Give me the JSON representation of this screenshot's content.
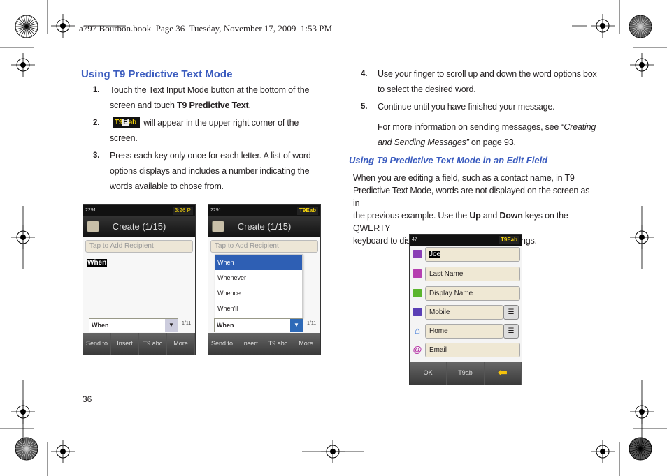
{
  "header": "a797 Bourbon.book  Page 36  Tuesday, November 17, 2009  1:53 PM",
  "left": {
    "heading": "Using T9 Predictive Text Mode",
    "steps": [
      {
        "num": "1.",
        "line1": "Touch the Text Input Mode button at the bottom of the",
        "line2a": "screen and touch ",
        "line2b": "T9 Predictive Text",
        "line2c": "."
      },
      {
        "num": "2.",
        "badge": "T9Eab",
        "line1": "will appear in the upper right corner of the",
        "line2": "screen."
      },
      {
        "num": "3.",
        "line1": "Press each key only once for each letter. A list of word",
        "line2": "options displays and includes a number indicating the",
        "line3": "words available to chose from."
      }
    ]
  },
  "phone1": {
    "status": "2291",
    "time": "3:26 P",
    "title": "Create (1/15)",
    "recipient": "Tap to Add Recipient",
    "text": "When",
    "combo": "When",
    "count": "1/11",
    "buttons": [
      "Send to",
      "Insert",
      "T9 abc",
      "More"
    ]
  },
  "phone2": {
    "status": "2291",
    "mode": "T9Eab",
    "title": "Create (1/15)",
    "recipient": "Tap to Add Recipient",
    "options": [
      "When",
      "Whenever",
      "Whence",
      "When'll"
    ],
    "combo": "When",
    "count": "1/11",
    "buttons": [
      "Send to",
      "Insert",
      "T9 abc",
      "More"
    ]
  },
  "right": {
    "steps": [
      {
        "num": "4.",
        "line1": "Use your finger to scroll up and down the word options box",
        "line2": "to select the desired word."
      },
      {
        "num": "5.",
        "line1": "Continue until you have finished your message."
      }
    ],
    "more1": "For more information on sending messages, see ",
    "more_italic1": "“Creating",
    "more_italic2": "and Sending Messages”",
    "more2": " on page 93.",
    "subheading": "Using T9 Predictive Text Mode in an Edit Field",
    "para": {
      "l1": "When you are editing a field, such as a contact name, in T9",
      "l2": "Predictive Text Mode, words are not displayed on the screen as in",
      "l3": "the previous example. Use the ",
      "up": "Up",
      "and": " and ",
      "down": "Down",
      "l3b": " keys on the QWERTY",
      "l4": "keyboard to display different suggested spellings."
    }
  },
  "phone3": {
    "status": "47",
    "mode": "T9Eab",
    "fields": [
      "Joe",
      "Last Name",
      "Display Name",
      "Mobile",
      "Home",
      "Email"
    ],
    "buttons": [
      "OK",
      "T9ab"
    ]
  },
  "page_number": "36"
}
